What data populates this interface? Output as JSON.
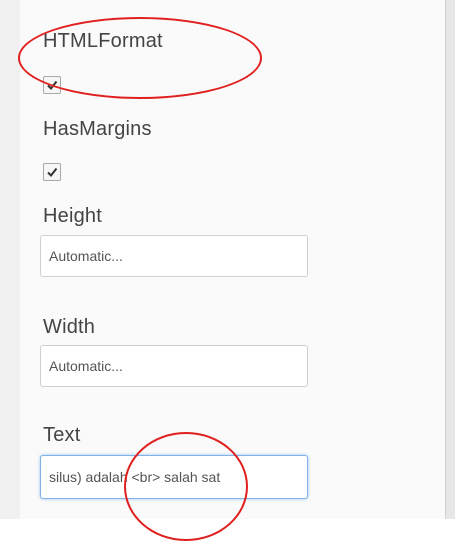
{
  "properties": [
    {
      "label": "HTMLFormat",
      "checked": true
    },
    {
      "label": "HasMargins",
      "checked": true
    },
    {
      "label": "Height",
      "value": "Automatic..."
    },
    {
      "label": "Width",
      "value": "Automatic..."
    },
    {
      "label": "Text",
      "value": "silus) adalah <br> salah sat"
    }
  ],
  "annotations": {
    "color": "#e0201f"
  }
}
